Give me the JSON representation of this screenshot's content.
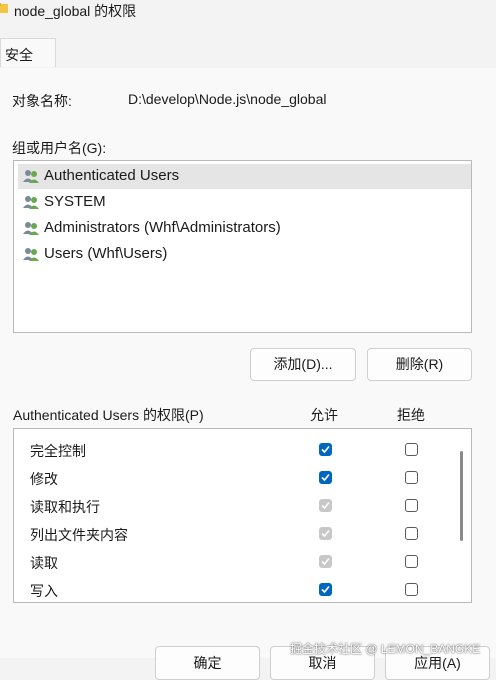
{
  "window": {
    "title": "node_global 的权限"
  },
  "tabs": [
    {
      "label": "安全"
    }
  ],
  "object_name": {
    "label": "对象名称:",
    "value": "D:\\develop\\Node.js\\node_global"
  },
  "groups": {
    "label": "组或用户名(G):",
    "items": [
      {
        "label": "Authenticated Users",
        "selected": true,
        "icon": "users-group-icon"
      },
      {
        "label": "SYSTEM",
        "icon": "users-group-icon"
      },
      {
        "label": "Administrators (Whf\\Administrators)",
        "icon": "users-group-icon"
      },
      {
        "label": "Users (Whf\\Users)",
        "icon": "users-group-icon"
      }
    ]
  },
  "buttons": {
    "add": "添加(D)...",
    "remove": "删除(R)",
    "ok": "确定",
    "cancel": "取消",
    "apply": "应用(A)"
  },
  "permissions": {
    "title": "Authenticated Users 的权限(P)",
    "allow_header": "允许",
    "deny_header": "拒绝",
    "rows": [
      {
        "name": "完全控制",
        "allow": "checked",
        "deny": "empty"
      },
      {
        "name": "修改",
        "allow": "checked",
        "deny": "empty"
      },
      {
        "name": "读取和执行",
        "allow": "disabled",
        "deny": "empty"
      },
      {
        "name": "列出文件夹内容",
        "allow": "disabled",
        "deny": "empty"
      },
      {
        "name": "读取",
        "allow": "disabled",
        "deny": "empty"
      },
      {
        "name": "写入",
        "allow": "checked",
        "deny": "empty"
      }
    ]
  },
  "watermark": "掘金技术社区 @ LEMON_BANGKE",
  "colors": {
    "accent": "#0067c0",
    "disabled_check": "#c8c8c8"
  }
}
